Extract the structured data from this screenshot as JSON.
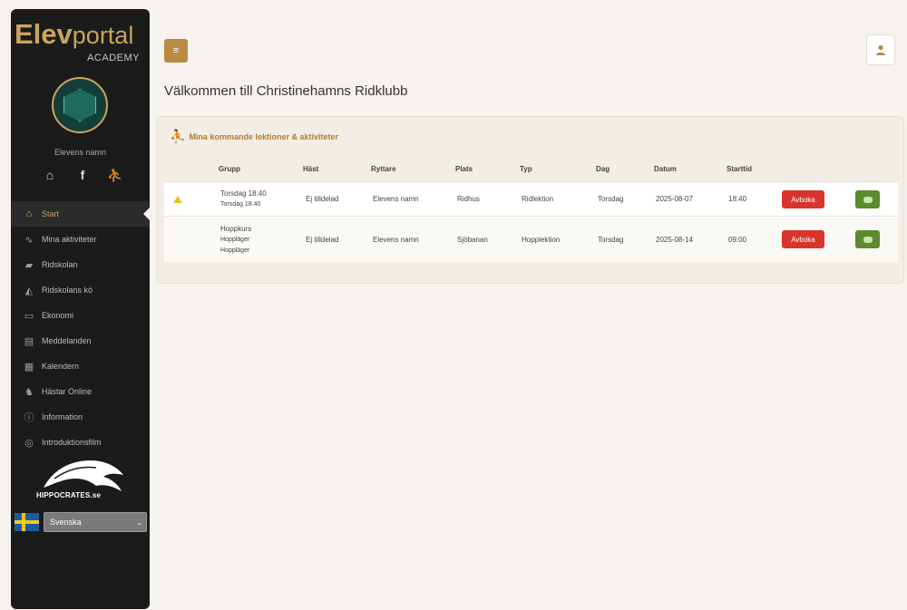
{
  "sidebar": {
    "brand_bold": "Elev",
    "brand_light": "portal",
    "brand_sub": "ACADEMY",
    "student_name": "Elevens namn",
    "quick_icons": [
      "home-icon",
      "facebook-icon",
      "rider-icon"
    ],
    "items": [
      {
        "label": "Start",
        "icon": "home-icon"
      },
      {
        "label": "Mina aktiviteter",
        "icon": "activity-icon"
      },
      {
        "label": "Ridskolan",
        "icon": "school-icon"
      },
      {
        "label": "Ridskolans kö",
        "icon": "queue-icon"
      },
      {
        "label": "Ekonomi",
        "icon": "money-icon"
      },
      {
        "label": "Meddelanden",
        "icon": "message-icon"
      },
      {
        "label": "Kalendern",
        "icon": "calendar-icon"
      },
      {
        "label": "Hästar Online",
        "icon": "horse-icon"
      },
      {
        "label": "Information",
        "icon": "info-icon"
      },
      {
        "label": "Introduktionsfilm",
        "icon": "film-icon"
      }
    ],
    "partner_logo_text": "HIPPOCRATES.se",
    "language": "Svenska"
  },
  "main": {
    "welcome": "Välkommen till Christinehamns Ridklubb",
    "card_title": "Mina kommande lektioner & aktiviteter",
    "columns": [
      "Grupp",
      "Häst",
      "Ryttare",
      "Plats",
      "Typ",
      "Dag",
      "Datum",
      "Starttid"
    ],
    "rows": [
      {
        "grupp": [
          "Torsdag 18:40",
          "Torsdag 18:40"
        ],
        "hast": "Ej tilldelad",
        "ryttare": "Elevens namn",
        "plats": "Ridhus",
        "typ": "Ridlektion",
        "dag": "Torsdag",
        "datum": "2025-08-07",
        "starttid": "18:40",
        "cancel": "Avboka"
      },
      {
        "grupp": [
          "Hoppkurs",
          "Hoppläger",
          "Hoppläger"
        ],
        "hast": "Ej tilldelad",
        "ryttare": "Elevens namn",
        "plats": "Sjöbanan",
        "typ": "Hopplektion",
        "dag": "Torsdag",
        "datum": "2025-08-14",
        "starttid": "09:00",
        "cancel": "Avboka"
      }
    ]
  }
}
